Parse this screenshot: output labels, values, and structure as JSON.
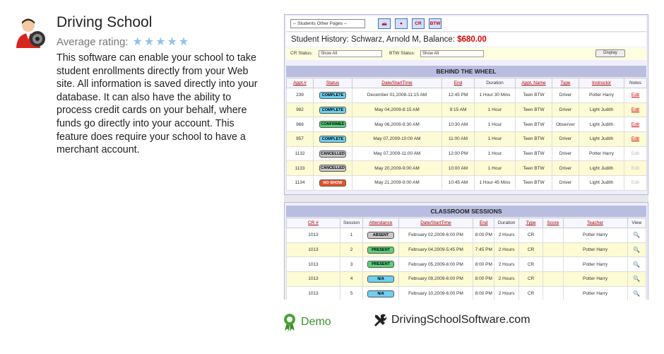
{
  "app": {
    "title": "Driving School",
    "rating_label": "Average rating:",
    "rating_stars": 5,
    "description": "This software can enable your school to take student enrollments directly from your Web site. All information is saved directly into your database. It can also have the ability to process credit cards on your behalf, where funds go directly into your account. This feature does require your school to have a merchant account."
  },
  "screenshot": {
    "pages_select": "-- Students Other Pages --",
    "tb_buttons": [
      "",
      "",
      "CR",
      "BTW"
    ],
    "history_prefix": "Student History: Schwarz, Arnold M, Balance: ",
    "balance": "$680.00",
    "cr_status_label": "CR Status:",
    "cr_status_value": "Show All",
    "btw_status_label": "BTW Status:",
    "btw_status_value": "Show All",
    "display_button": "Display",
    "btw_title": "BEHIND THE WHEEL",
    "btw_headers": [
      "Appt.#",
      "Status",
      "Date/StartTime",
      "End",
      "Duration",
      "Appt. Name",
      "Type",
      "Instructor",
      "Notes"
    ],
    "btw_rows": [
      {
        "appt": "239",
        "status": "COMPLETE",
        "date": "December 01,2008-11:15 AM",
        "end": "12:45 PM",
        "duration": "1 Hour 30 Mins",
        "name": "Teen BTW",
        "type": "Driver",
        "instructor": "Potter Harry",
        "notes": "Edit"
      },
      {
        "appt": "982",
        "status": "COMPLETE",
        "date": "May 04,2009-8:15 AM",
        "end": "9:15 AM",
        "duration": "1 Hour",
        "name": "Teen BTW",
        "type": "Driver",
        "instructor": "Light Judith",
        "notes": "Edit"
      },
      {
        "appt": "968",
        "status": "CONFIRMED",
        "date": "May 06,2009-9:30 AM",
        "end": "10:30 AM",
        "duration": "1 Hour",
        "name": "Teen BTW",
        "type": "Observer",
        "instructor": "Light Judith",
        "notes": "Edit"
      },
      {
        "appt": "957",
        "status": "COMPLETE",
        "date": "May 07,2009-10:00 AM",
        "end": "11:00 AM",
        "duration": "1 Hour",
        "name": "Teen BTW",
        "type": "Driver",
        "instructor": "Light Judith",
        "notes": "Edit"
      },
      {
        "appt": "1132",
        "status": "CANCELLED",
        "date": "May 07,2009-11:00 AM",
        "end": "12:00 PM",
        "duration": "1 Hour",
        "name": "Teen BTW",
        "type": "Driver",
        "instructor": "Potter Harry",
        "notes": "Edit"
      },
      {
        "appt": "1133",
        "status": "CANCELLED",
        "date": "May 20,2009-9:00 AM",
        "end": "10:00 AM",
        "duration": "1 Hour",
        "name": "Teen BTW",
        "type": "Driver",
        "instructor": "Light Judith",
        "notes": "Edit"
      },
      {
        "appt": "1134",
        "status": "NO SHOW",
        "date": "May 21,2009-9:00 AM",
        "end": "10:45 AM",
        "duration": "1 Hour 45 Mins",
        "name": "Teen BTW",
        "type": "Driver",
        "instructor": "Light Judith",
        "notes": "Edit"
      }
    ],
    "cr_title": "CLASSROOM SESSIONS",
    "cr_headers": [
      "CR #",
      "Session",
      "Attendance",
      "Date/StartTime",
      "End",
      "Duration",
      "Type",
      "Score",
      "Teacher",
      "View"
    ],
    "cr_rows": [
      {
        "cr": "1013",
        "session": "1",
        "attendance": "ABSENT",
        "date": "February 02,2009-6:00 PM",
        "end": "8:00 PM",
        "duration": "2 Hours",
        "type": "CR",
        "score": "",
        "teacher": "Potter Harry"
      },
      {
        "cr": "1013",
        "session": "2",
        "attendance": "PRESENT",
        "date": "February 04,2009-5:45 PM",
        "end": "7:45 PM",
        "duration": "2 Hours",
        "type": "CR",
        "score": "",
        "teacher": "Potter Harry"
      },
      {
        "cr": "1013",
        "session": "3",
        "attendance": "PRESENT",
        "date": "February 05,2009-6:00 PM",
        "end": "8:00 PM",
        "duration": "2 Hours",
        "type": "CR",
        "score": "",
        "teacher": "Potter Harry"
      },
      {
        "cr": "1013",
        "session": "4",
        "attendance": "N/A",
        "date": "February 09,2009-6:00 PM",
        "end": "8:00 PM",
        "duration": "2 Hours",
        "type": "CR",
        "score": "",
        "teacher": "Potter Harry"
      },
      {
        "cr": "1013",
        "session": "5",
        "attendance": "N/A",
        "date": "February 10,2009-6:00 PM",
        "end": "8:00 PM",
        "duration": "2 Hours",
        "type": "CR",
        "score": "",
        "teacher": "Potter Harry"
      }
    ]
  },
  "links": {
    "demo": "Demo",
    "site": "DrivingSchoolSoftware.com"
  },
  "colors": {
    "balance": "#dd0000",
    "demo": "#3d8f2d",
    "star": "#8fc3ec"
  }
}
